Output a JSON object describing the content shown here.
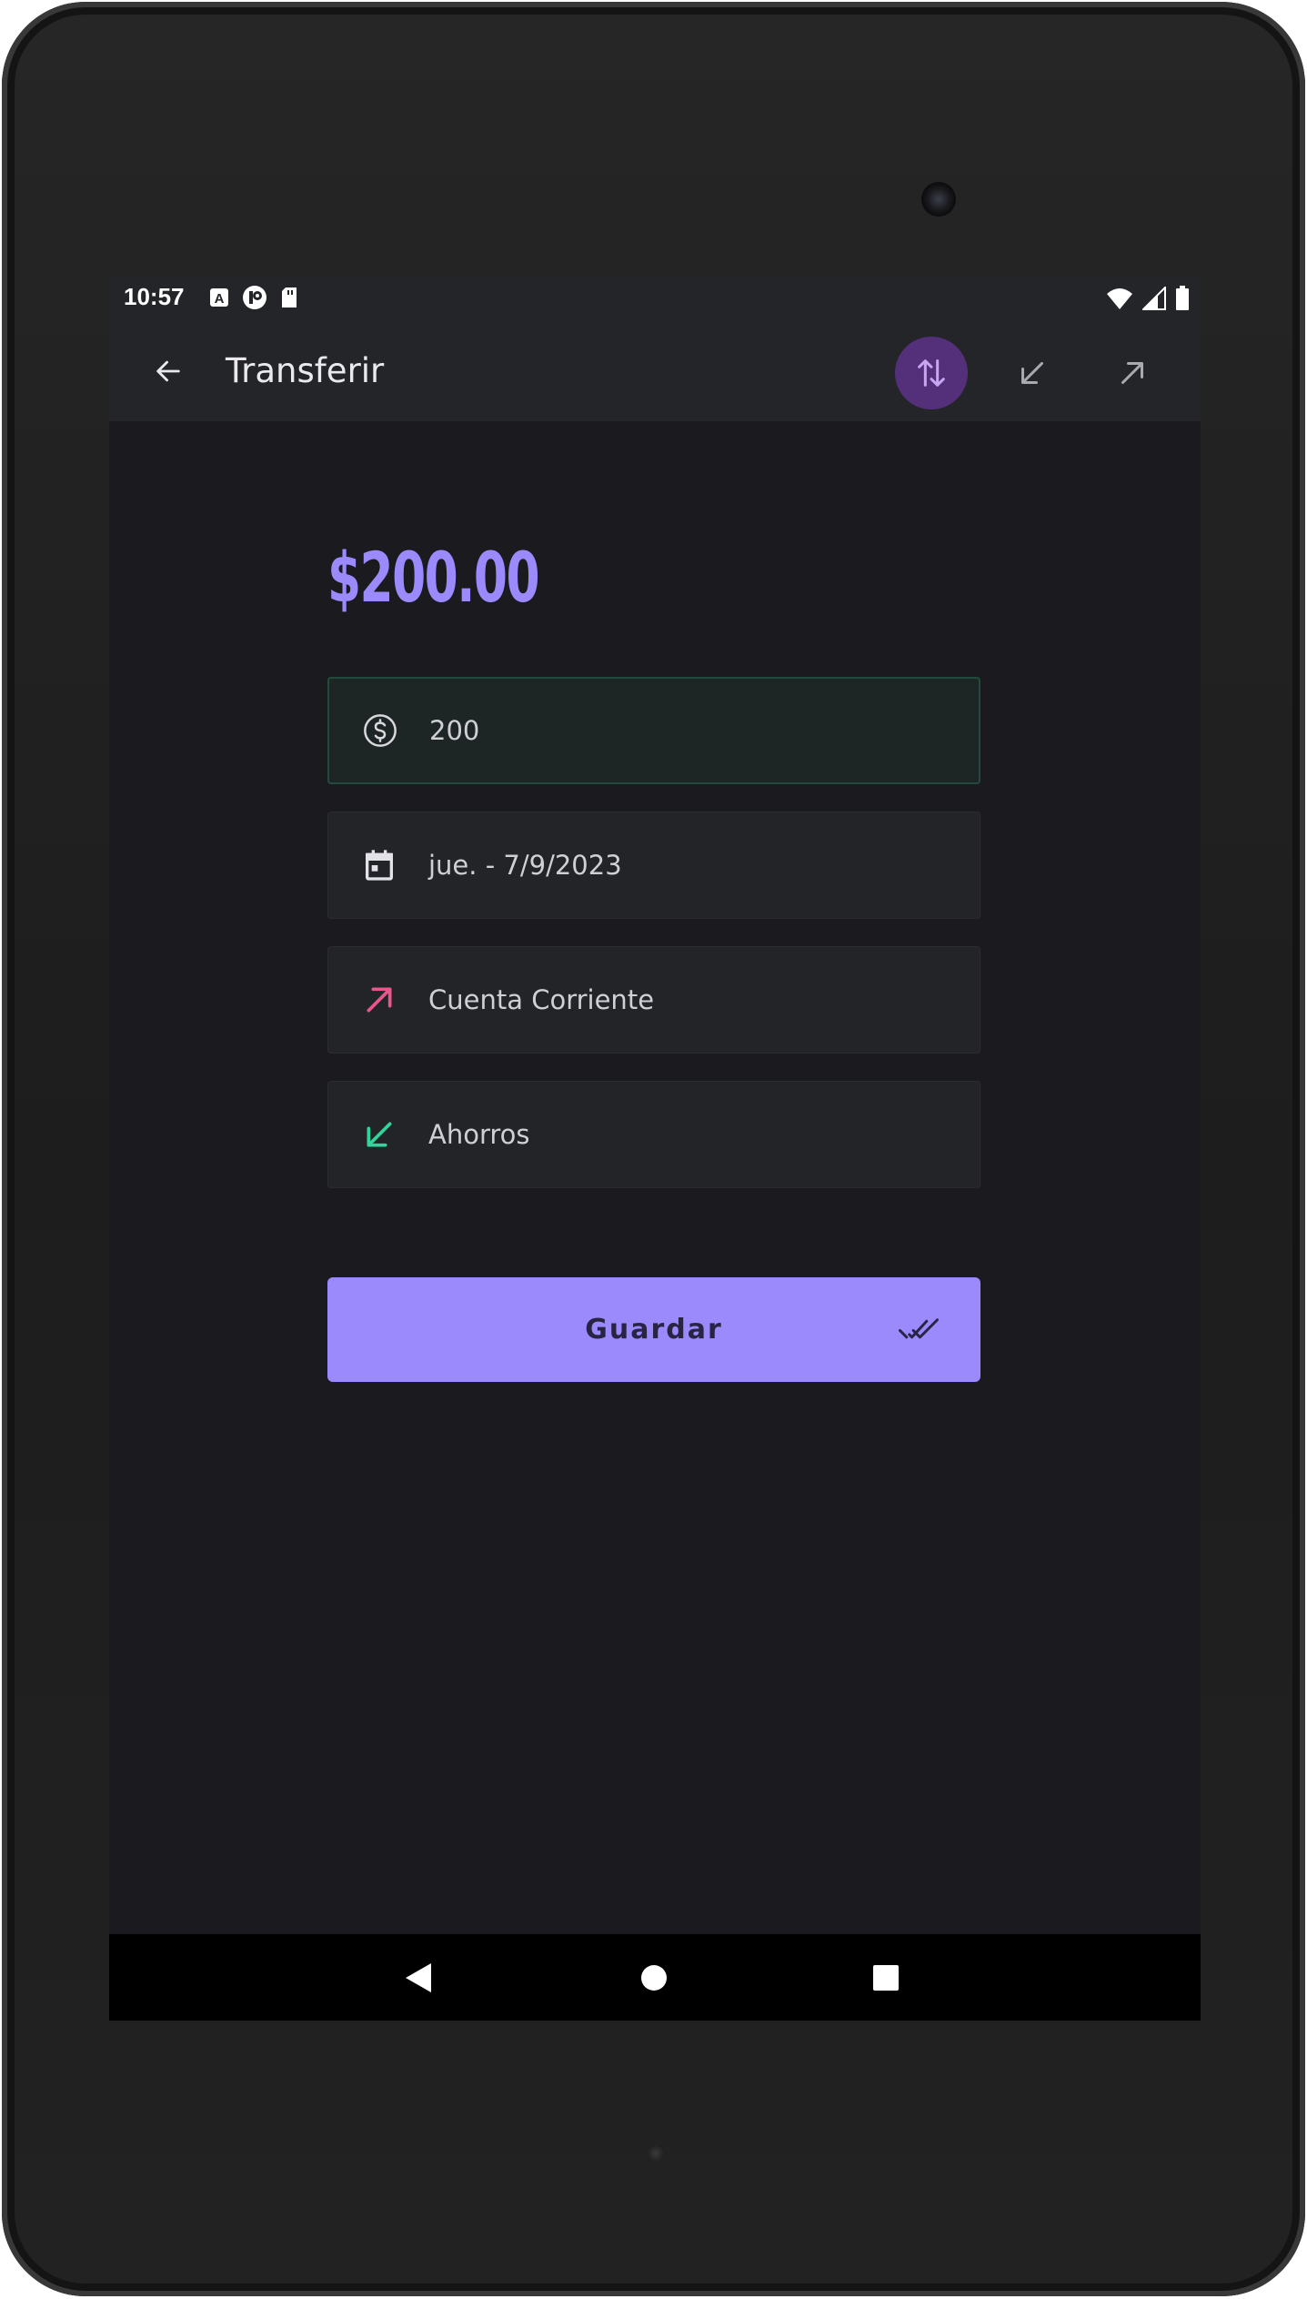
{
  "status_bar": {
    "time": "10:57",
    "left_icons": [
      "app-a-icon",
      "app-p-icon",
      "sd-card-icon"
    ],
    "right_icons": [
      "wifi-icon",
      "signal-icon",
      "battery-icon"
    ]
  },
  "top_bar": {
    "title": "Transferir",
    "back_icon": "arrow-left-icon",
    "actions": [
      {
        "name": "transfer-toggle",
        "icon": "swap-vertical-icon",
        "active": true
      },
      {
        "name": "income-toggle",
        "icon": "arrow-down-left-icon",
        "active": false
      },
      {
        "name": "expense-toggle",
        "icon": "arrow-up-right-icon",
        "active": false
      }
    ]
  },
  "form": {
    "amount_display": "$200.00",
    "fields": [
      {
        "name": "amount-field",
        "icon": "dollar-circle-icon",
        "value": "200",
        "focused": true
      },
      {
        "name": "date-field",
        "icon": "calendar-icon",
        "value": "jue. - 7/9/2023",
        "focused": false
      },
      {
        "name": "from-account-field",
        "icon": "arrow-up-right-icon",
        "value": "Cuenta Corriente",
        "icon_color": "#e8568a"
      },
      {
        "name": "to-account-field",
        "icon": "arrow-down-left-icon",
        "value": "Ahorros",
        "icon_color": "#2fd59a"
      }
    ],
    "save_label": "Guardar",
    "save_icon": "double-check-icon"
  },
  "nav_bar": {
    "buttons": [
      "back-triangle-icon",
      "home-circle-icon",
      "recents-square-icon"
    ]
  },
  "colors": {
    "accent": "#9a8afc",
    "active_chip": "#54307a",
    "background": "#1b1b1f",
    "surface": "#232428",
    "expense": "#e8568a",
    "income": "#2fd59a"
  }
}
